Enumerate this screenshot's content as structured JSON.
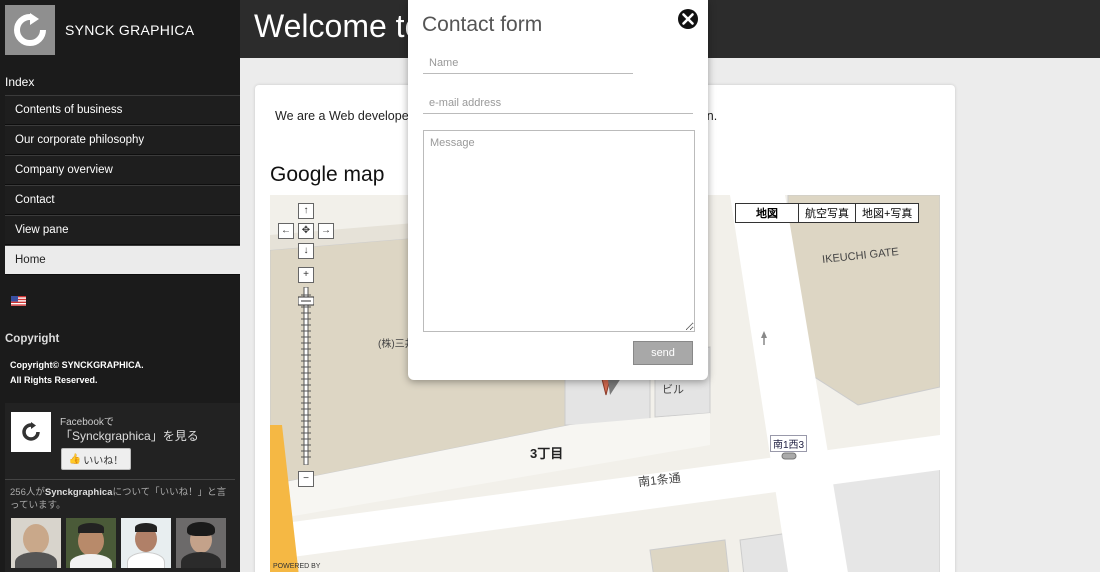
{
  "sidebar": {
    "site_name": "SYNCK GRAPHICA",
    "index_label": "Index",
    "nav": [
      {
        "label": "Contents of business"
      },
      {
        "label": "Our corporate philosophy"
      },
      {
        "label": "Company overview"
      },
      {
        "label": "Contact"
      },
      {
        "label": "View pane"
      },
      {
        "label": "Home"
      }
    ],
    "copyright_title": "Copyright",
    "copyright_line1": "Copyright© SYNCKGRAPHICA.",
    "copyright_line2": "All Rights Reserved."
  },
  "facebook": {
    "line1": "Facebookで",
    "line2": "「Synckgraphica」を見る",
    "like_label": "いいね！",
    "count_prefix": "256人が",
    "count_name": "Synckgraphica",
    "count_suffix": "について「いいね！」と言っています。"
  },
  "header": {
    "title": "Welcome to our Website"
  },
  "main": {
    "intro": "We are a Web developer in Sapporo, we specialize in web and interface design.",
    "map_heading": "Google map",
    "map": {
      "type_buttons": [
        "地図",
        "航空写真",
        "地図+写真"
      ],
      "labels": {
        "ikeuchi": "IKEUCHI GATE",
        "mitsu": "(株)三井",
        "building": "ビル",
        "chome": "3丁目",
        "street": "南1条通",
        "station": "南1西3"
      },
      "powered": "POWERED BY"
    }
  },
  "modal": {
    "title": "Contact form",
    "name_placeholder": "Name",
    "email_placeholder": "e-mail address",
    "message_placeholder": "Message",
    "send_label": "send"
  },
  "colors": {
    "sidebar_bg": "#1b1b1b",
    "header_bg": "#2c2c2c",
    "send_bg": "#a8a8a8"
  }
}
